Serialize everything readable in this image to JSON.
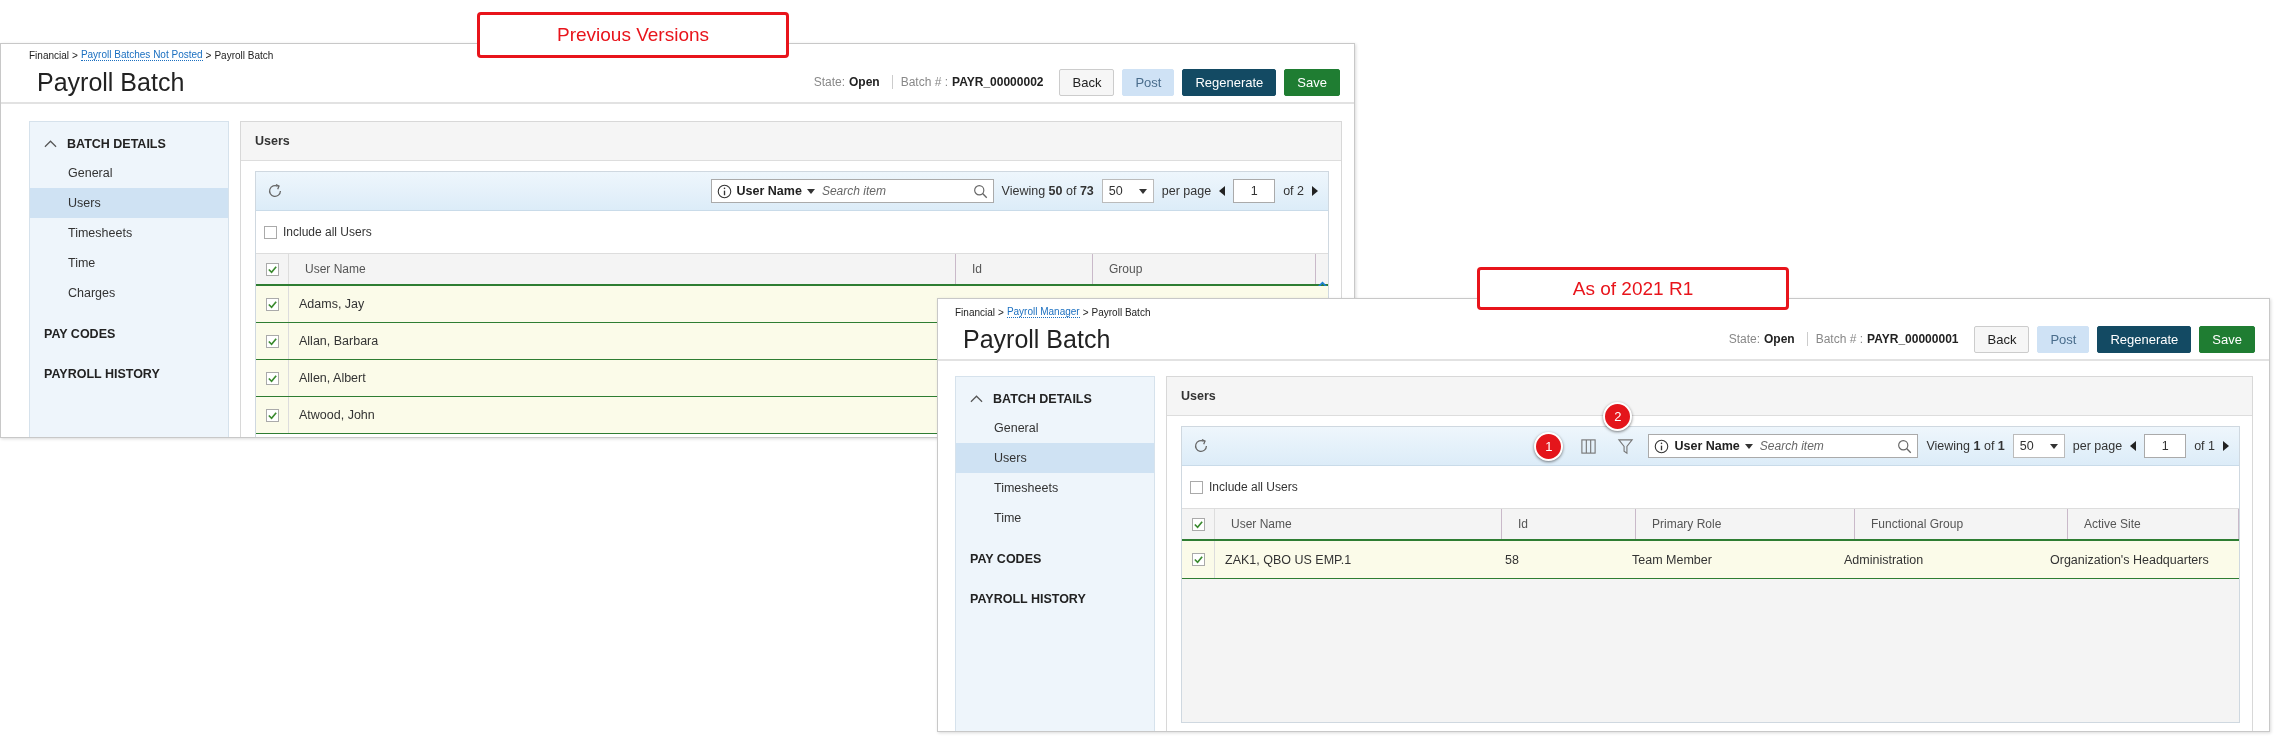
{
  "callouts": [
    {
      "text": "Previous Versions"
    },
    {
      "text": "As of 2021 R1"
    }
  ],
  "panels": [
    {
      "breadcrumb": [
        {
          "text": "Financial",
          "link": false
        },
        {
          "text": "Payroll Batches Not Posted",
          "link": true
        },
        {
          "text": "Payroll Batch",
          "link": false
        }
      ],
      "separator": ">",
      "title": "Payroll Batch",
      "state_label": "State:",
      "state": "Open",
      "batch_label": "Batch # :",
      "batch": "PAYR_00000002",
      "buttons": [
        {
          "label": "Back",
          "kind": "default"
        },
        {
          "label": "Post",
          "kind": "light"
        },
        {
          "label": "Regenerate",
          "kind": "dark"
        },
        {
          "label": "Save",
          "kind": "success"
        }
      ],
      "sidebar": [
        {
          "label": "BATCH DETAILS",
          "expanded": true,
          "children": [
            {
              "label": "General",
              "selected": false
            },
            {
              "label": "Users",
              "selected": true
            },
            {
              "label": "Timesheets",
              "selected": false
            },
            {
              "label": "Time",
              "selected": false
            },
            {
              "label": "Charges",
              "selected": false
            }
          ]
        },
        {
          "label": "PAY CODES"
        },
        {
          "label": "PAYROLL HISTORY"
        }
      ],
      "section_title": "Users",
      "search": {
        "field": "User Name",
        "placeholder": "Search item"
      },
      "viewing": "Viewing **50** of **73**",
      "page_size": "50",
      "per_page": "per page",
      "page": "1",
      "of_pages": "of 2",
      "include_all": {
        "label": "Include all Users",
        "checked": false
      },
      "grid": {
        "header_checked": true,
        "scroll_up": true,
        "columns": [
          "User Name",
          "Id",
          "Group"
        ],
        "rows": [
          {
            "checked": true,
            "cells": [
              "Adams, Jay"
            ]
          },
          {
            "checked": true,
            "cells": [
              "Allan, Barbara"
            ]
          },
          {
            "checked": true,
            "cells": [
              "Allen, Albert"
            ]
          },
          {
            "checked": true,
            "cells": [
              "Atwood, John"
            ]
          }
        ]
      }
    },
    {
      "breadcrumb": [
        {
          "text": "Financial",
          "link": false
        },
        {
          "text": "Payroll Manager",
          "link": true
        },
        {
          "text": "Payroll Batch",
          "link": false
        }
      ],
      "separator": ">",
      "title": "Payroll Batch",
      "state_label": "State:",
      "state": "Open",
      "batch_label": "Batch # :",
      "batch": "PAYR_00000001",
      "buttons": [
        {
          "label": "Back",
          "kind": "default"
        },
        {
          "label": "Post",
          "kind": "light"
        },
        {
          "label": "Regenerate",
          "kind": "dark"
        },
        {
          "label": "Save",
          "kind": "success"
        }
      ],
      "sidebar": [
        {
          "label": "BATCH DETAILS",
          "expanded": true,
          "children": [
            {
              "label": "General",
              "selected": false
            },
            {
              "label": "Users",
              "selected": true
            },
            {
              "label": "Timesheets",
              "selected": false
            },
            {
              "label": "Time",
              "selected": false
            }
          ]
        },
        {
          "label": "PAY CODES"
        },
        {
          "label": "PAYROLL HISTORY"
        }
      ],
      "section_title": "Users",
      "tools": [
        {
          "kind": "columns",
          "badge": "1"
        },
        {
          "kind": "filter",
          "badge": "2"
        }
      ],
      "search": {
        "field": "User Name",
        "placeholder": "Search item"
      },
      "viewing": "Viewing **1** of **1**",
      "page_size": "50",
      "per_page": "per page",
      "page": "1",
      "of_pages": "of 1",
      "include_all": {
        "label": "Include all Users",
        "checked": false
      },
      "grid": {
        "header_checked": true,
        "scroll_up": false,
        "columns": [
          "User Name",
          "Id",
          "Primary Role",
          "Functional Group",
          "Active Site"
        ],
        "rows": [
          {
            "checked": true,
            "cells": [
              "ZAK1, QBO US EMP.1",
              "58",
              "Team Member",
              "Administration",
              "Organization's Headquarters"
            ]
          }
        ]
      }
    }
  ]
}
